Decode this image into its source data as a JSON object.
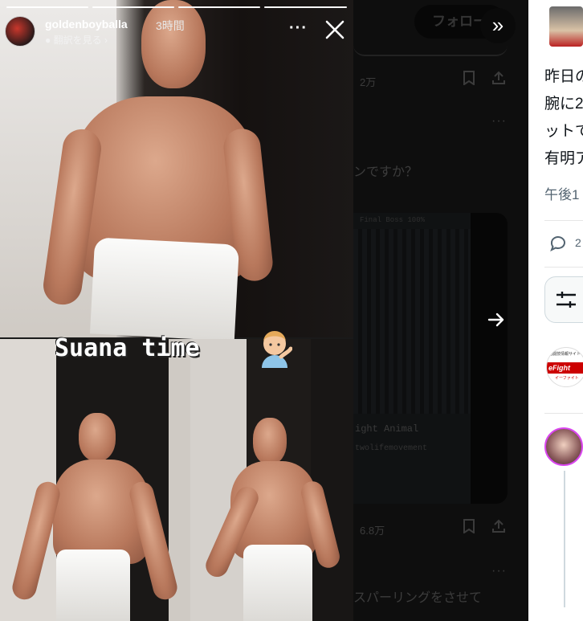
{
  "story": {
    "username": "goldenboyballa",
    "timestamp": "3時間",
    "translate_label": "翻訳を見る",
    "caption": "Suana time",
    "progress_segments": 4,
    "current_segment": 4
  },
  "feed": {
    "follow_label": "フォロー",
    "stat1": "2万",
    "stat2": "6.8万",
    "question_fragment": "ンですか？",
    "card_caption1": "ight Animal",
    "card_caption2": "twolifemovement",
    "card_caption0": "Final Boss 100%",
    "bottom_fragment": "スパーリングをさせて"
  },
  "sidebar": {
    "lines": [
      "昨日の",
      "腕に2",
      "ットで",
      "有明ア"
    ],
    "time": "午後1",
    "reply_count": "2",
    "logo_top": "格闘技情報サイト",
    "logo_text": "eFight",
    "logo_sub": "イーファイト"
  }
}
